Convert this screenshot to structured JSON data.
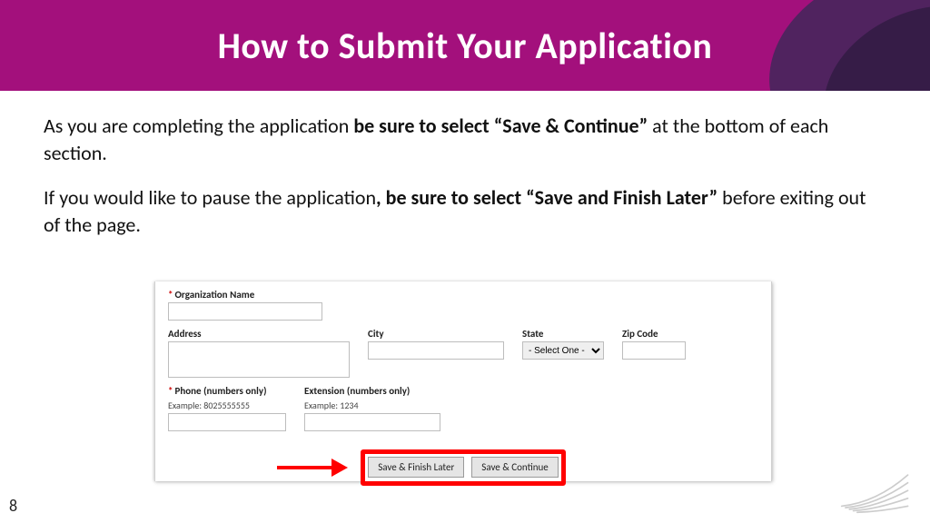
{
  "header": {
    "title": "How to Submit Your Application"
  },
  "body": {
    "p1_a": "As you are completing the application ",
    "p1_b": "be sure to select “Save & Continue”",
    "p1_c": " at the bottom of each section.",
    "p2_a": "If you would like to pause the application",
    "p2_b": ", be sure to select “Save and Finish Later”",
    "p2_c": " before exiting out of the page."
  },
  "form": {
    "org_label": "Organization Name",
    "address_label": "Address",
    "city_label": "City",
    "state_label": "State",
    "state_selected": "- Select One -",
    "zip_label": "Zip Code",
    "phone_label": "Phone (numbers only)",
    "phone_hint": "Example: 8025555555",
    "ext_label": "Extension (numbers only)",
    "ext_hint": "Example: 1234",
    "btn_save_later": "Save & Finish Later",
    "btn_save_continue": "Save & Continue"
  },
  "page_number": "8",
  "colors": {
    "banner": "#a3107c",
    "highlight": "#ff0000"
  }
}
